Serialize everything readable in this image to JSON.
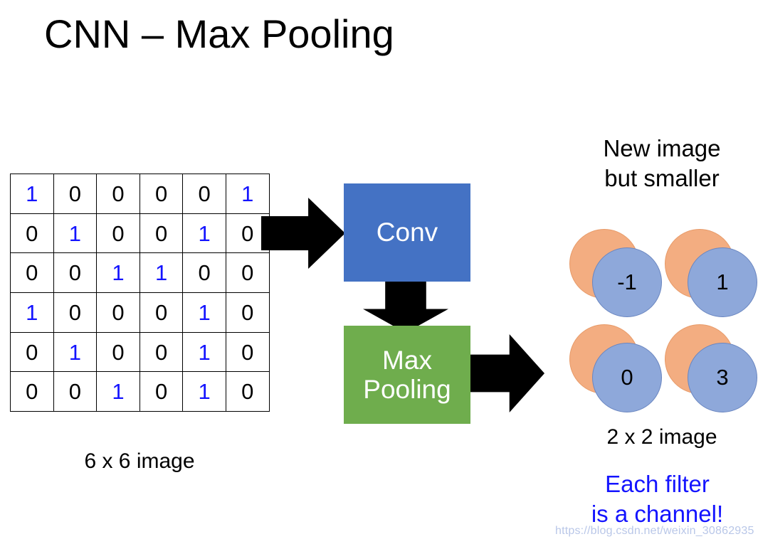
{
  "slide": {
    "title": "CNN – Max Pooling",
    "background_color": "#ffffff"
  },
  "input_matrix": {
    "caption": "6 x 6 image",
    "rows": 6,
    "cols": 6,
    "zero_color": "#000000",
    "one_color": "#1414ff",
    "values": [
      [
        "1",
        "0",
        "0",
        "0",
        "0",
        "1"
      ],
      [
        "0",
        "1",
        "0",
        "0",
        "1",
        "0"
      ],
      [
        "0",
        "0",
        "1",
        "1",
        "0",
        "0"
      ],
      [
        "1",
        "0",
        "0",
        "0",
        "1",
        "0"
      ],
      [
        "0",
        "1",
        "0",
        "0",
        "1",
        "0"
      ],
      [
        "0",
        "0",
        "1",
        "0",
        "1",
        "0"
      ]
    ]
  },
  "pipeline": {
    "conv": {
      "label": "Conv",
      "color": "#4472c4",
      "text_color": "#ffffff"
    },
    "maxpool": {
      "label": "Max\nPooling",
      "color": "#6fad4d",
      "text_color": "#ffffff"
    },
    "arrows": {
      "grid_to_conv": "arrow-right",
      "conv_to_pool": "arrow-down",
      "pool_to_output": "arrow-right",
      "color": "#000000"
    }
  },
  "output": {
    "heading": "New image\nbut smaller",
    "caption": "2 x 2 image",
    "note": "Each filter\nis a channel!",
    "note_color": "#1414ff",
    "front_color": "#8ea8da",
    "back_color": "#f3ad81",
    "cells": [
      {
        "front": "-1",
        "back": ""
      },
      {
        "front": "1",
        "back": ""
      },
      {
        "front": "0",
        "back": ""
      },
      {
        "front": "3",
        "back": ""
      }
    ]
  },
  "watermark": {
    "text": "https://blog.csdn.net/weixin_30862935"
  }
}
